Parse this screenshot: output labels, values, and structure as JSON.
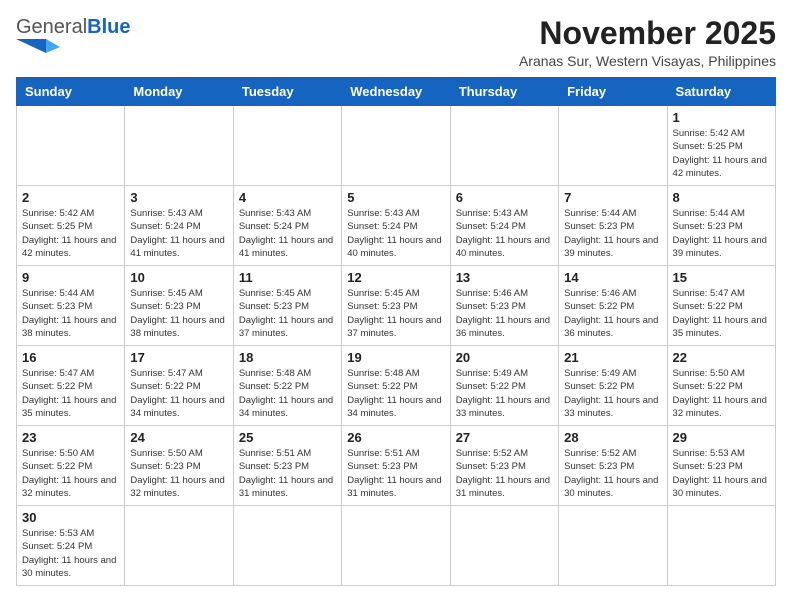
{
  "header": {
    "logo_general": "General",
    "logo_blue": "Blue",
    "month_year": "November 2025",
    "location": "Aranas Sur, Western Visayas, Philippines"
  },
  "weekdays": [
    "Sunday",
    "Monday",
    "Tuesday",
    "Wednesday",
    "Thursday",
    "Friday",
    "Saturday"
  ],
  "weeks": [
    [
      {
        "day": null
      },
      {
        "day": null
      },
      {
        "day": null
      },
      {
        "day": null
      },
      {
        "day": null
      },
      {
        "day": null
      },
      {
        "day": 1,
        "sunrise": "Sunrise: 5:42 AM",
        "sunset": "Sunset: 5:25 PM",
        "daylight": "Daylight: 11 hours and 42 minutes."
      }
    ],
    [
      {
        "day": 2,
        "sunrise": "Sunrise: 5:42 AM",
        "sunset": "Sunset: 5:25 PM",
        "daylight": "Daylight: 11 hours and 42 minutes."
      },
      {
        "day": 3,
        "sunrise": "Sunrise: 5:43 AM",
        "sunset": "Sunset: 5:24 PM",
        "daylight": "Daylight: 11 hours and 41 minutes."
      },
      {
        "day": 4,
        "sunrise": "Sunrise: 5:43 AM",
        "sunset": "Sunset: 5:24 PM",
        "daylight": "Daylight: 11 hours and 41 minutes."
      },
      {
        "day": 5,
        "sunrise": "Sunrise: 5:43 AM",
        "sunset": "Sunset: 5:24 PM",
        "daylight": "Daylight: 11 hours and 40 minutes."
      },
      {
        "day": 6,
        "sunrise": "Sunrise: 5:43 AM",
        "sunset": "Sunset: 5:24 PM",
        "daylight": "Daylight: 11 hours and 40 minutes."
      },
      {
        "day": 7,
        "sunrise": "Sunrise: 5:44 AM",
        "sunset": "Sunset: 5:23 PM",
        "daylight": "Daylight: 11 hours and 39 minutes."
      },
      {
        "day": 8,
        "sunrise": "Sunrise: 5:44 AM",
        "sunset": "Sunset: 5:23 PM",
        "daylight": "Daylight: 11 hours and 39 minutes."
      }
    ],
    [
      {
        "day": 9,
        "sunrise": "Sunrise: 5:44 AM",
        "sunset": "Sunset: 5:23 PM",
        "daylight": "Daylight: 11 hours and 38 minutes."
      },
      {
        "day": 10,
        "sunrise": "Sunrise: 5:45 AM",
        "sunset": "Sunset: 5:23 PM",
        "daylight": "Daylight: 11 hours and 38 minutes."
      },
      {
        "day": 11,
        "sunrise": "Sunrise: 5:45 AM",
        "sunset": "Sunset: 5:23 PM",
        "daylight": "Daylight: 11 hours and 37 minutes."
      },
      {
        "day": 12,
        "sunrise": "Sunrise: 5:45 AM",
        "sunset": "Sunset: 5:23 PM",
        "daylight": "Daylight: 11 hours and 37 minutes."
      },
      {
        "day": 13,
        "sunrise": "Sunrise: 5:46 AM",
        "sunset": "Sunset: 5:23 PM",
        "daylight": "Daylight: 11 hours and 36 minutes."
      },
      {
        "day": 14,
        "sunrise": "Sunrise: 5:46 AM",
        "sunset": "Sunset: 5:22 PM",
        "daylight": "Daylight: 11 hours and 36 minutes."
      },
      {
        "day": 15,
        "sunrise": "Sunrise: 5:47 AM",
        "sunset": "Sunset: 5:22 PM",
        "daylight": "Daylight: 11 hours and 35 minutes."
      }
    ],
    [
      {
        "day": 16,
        "sunrise": "Sunrise: 5:47 AM",
        "sunset": "Sunset: 5:22 PM",
        "daylight": "Daylight: 11 hours and 35 minutes."
      },
      {
        "day": 17,
        "sunrise": "Sunrise: 5:47 AM",
        "sunset": "Sunset: 5:22 PM",
        "daylight": "Daylight: 11 hours and 34 minutes."
      },
      {
        "day": 18,
        "sunrise": "Sunrise: 5:48 AM",
        "sunset": "Sunset: 5:22 PM",
        "daylight": "Daylight: 11 hours and 34 minutes."
      },
      {
        "day": 19,
        "sunrise": "Sunrise: 5:48 AM",
        "sunset": "Sunset: 5:22 PM",
        "daylight": "Daylight: 11 hours and 34 minutes."
      },
      {
        "day": 20,
        "sunrise": "Sunrise: 5:49 AM",
        "sunset": "Sunset: 5:22 PM",
        "daylight": "Daylight: 11 hours and 33 minutes."
      },
      {
        "day": 21,
        "sunrise": "Sunrise: 5:49 AM",
        "sunset": "Sunset: 5:22 PM",
        "daylight": "Daylight: 11 hours and 33 minutes."
      },
      {
        "day": 22,
        "sunrise": "Sunrise: 5:50 AM",
        "sunset": "Sunset: 5:22 PM",
        "daylight": "Daylight: 11 hours and 32 minutes."
      }
    ],
    [
      {
        "day": 23,
        "sunrise": "Sunrise: 5:50 AM",
        "sunset": "Sunset: 5:22 PM",
        "daylight": "Daylight: 11 hours and 32 minutes."
      },
      {
        "day": 24,
        "sunrise": "Sunrise: 5:50 AM",
        "sunset": "Sunset: 5:23 PM",
        "daylight": "Daylight: 11 hours and 32 minutes."
      },
      {
        "day": 25,
        "sunrise": "Sunrise: 5:51 AM",
        "sunset": "Sunset: 5:23 PM",
        "daylight": "Daylight: 11 hours and 31 minutes."
      },
      {
        "day": 26,
        "sunrise": "Sunrise: 5:51 AM",
        "sunset": "Sunset: 5:23 PM",
        "daylight": "Daylight: 11 hours and 31 minutes."
      },
      {
        "day": 27,
        "sunrise": "Sunrise: 5:52 AM",
        "sunset": "Sunset: 5:23 PM",
        "daylight": "Daylight: 11 hours and 31 minutes."
      },
      {
        "day": 28,
        "sunrise": "Sunrise: 5:52 AM",
        "sunset": "Sunset: 5:23 PM",
        "daylight": "Daylight: 11 hours and 30 minutes."
      },
      {
        "day": 29,
        "sunrise": "Sunrise: 5:53 AM",
        "sunset": "Sunset: 5:23 PM",
        "daylight": "Daylight: 11 hours and 30 minutes."
      }
    ],
    [
      {
        "day": 30,
        "sunrise": "Sunrise: 5:53 AM",
        "sunset": "Sunset: 5:24 PM",
        "daylight": "Daylight: 11 hours and 30 minutes."
      },
      {
        "day": null
      },
      {
        "day": null
      },
      {
        "day": null
      },
      {
        "day": null
      },
      {
        "day": null
      },
      {
        "day": null
      }
    ]
  ]
}
